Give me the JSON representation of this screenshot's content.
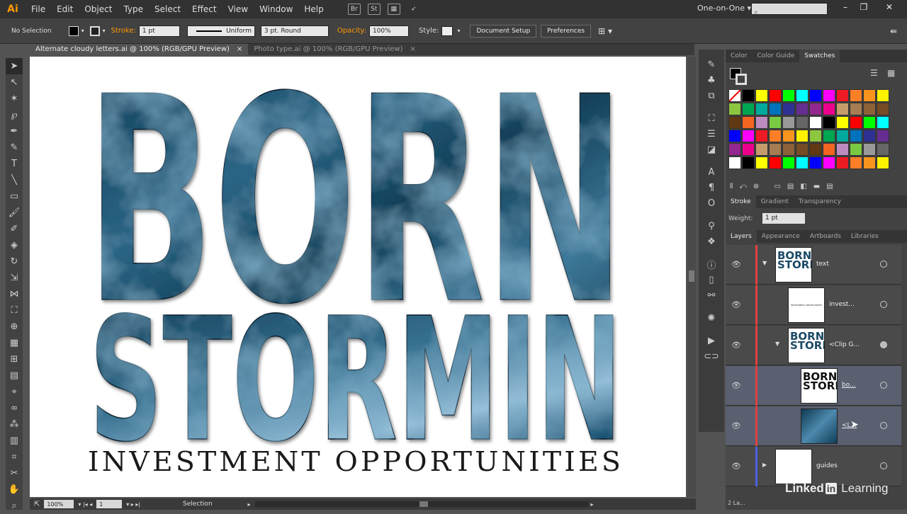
{
  "app": {
    "logo": "Ai",
    "menu": [
      "File",
      "Edit",
      "Object",
      "Type",
      "Select",
      "Effect",
      "View",
      "Window",
      "Help"
    ],
    "workspace": "One-on-One",
    "app_icons": [
      "Br",
      "St",
      "arrange-icon",
      "gpu-icon"
    ]
  },
  "control": {
    "selection": "No Selection",
    "stroke_label": "Stroke:",
    "stroke_weight": "1 pt",
    "profile": "Uniform",
    "brush": "3 pt. Round",
    "opacity_label": "Opacity:",
    "opacity": "100%",
    "style_label": "Style:",
    "doc_setup": "Document Setup",
    "preferences": "Preferences"
  },
  "tabs": [
    {
      "label": "Alternate cloudy letters.ai @ 100% (RGB/GPU Preview)",
      "close": "×"
    },
    {
      "label": "Photo type.ai @ 100% (RGB/GPU Preview)",
      "close": "×"
    }
  ],
  "art": {
    "line1": "BORN",
    "line2": "STORMIN",
    "line3": "INVESTMENT OPPORTUNITIES"
  },
  "status": {
    "zoom": "100%",
    "page": "1",
    "tool": "Selection"
  },
  "swatch_panel": {
    "tabs": [
      "Color",
      "Color Guide",
      "Swatches"
    ],
    "active": "Swatches"
  },
  "stroke_panel": {
    "tabs": [
      "Stroke",
      "Gradient",
      "Transparency"
    ],
    "weight_label": "Weight:",
    "weight": "1 pt"
  },
  "layers_panel": {
    "tabs": [
      "Layers",
      "Appearance",
      "Artboards",
      "Libraries"
    ],
    "count": "2 La...",
    "rows": [
      {
        "name": "text",
        "thumb": "BORN STORMIN"
      },
      {
        "name": "invest...",
        "thumb": "INVESTMENT OPPORTUNITIES"
      },
      {
        "name": "<Clip G...",
        "thumb": "BORN STORMIN"
      },
      {
        "name": "bo...",
        "thumb": "BORN STORMIN"
      },
      {
        "name": "<L...",
        "thumb": ""
      },
      {
        "name": "guides",
        "thumb": ""
      }
    ]
  },
  "watermark": {
    "brand1": "Linked",
    "brand2": "in",
    "brand3": "Learning"
  },
  "colors": {
    "cloud_dark": "#103a52",
    "cloud_mid": "#2e6888",
    "cloud_light": "#9cc4de",
    "ui_bg": "#535353",
    "accent": "#ff9a00"
  },
  "swatches": [
    "#ffffff",
    "#000000",
    "#ffff00",
    "#ff0000",
    "#00ff00",
    "#00ffff",
    "#0000ff",
    "#ff00ff",
    "#ed1c24",
    "#ff7f27",
    "#f7941d",
    "#fff200",
    "#8dc63f",
    "#00a651",
    "#00a99d",
    "#0072bc",
    "#2e3192",
    "#662d91",
    "#92278f",
    "#ec008c",
    "#c69c6d",
    "#a67c52",
    "#8c6239",
    "#754c24",
    "#603913",
    "#f26522",
    "#bd8cbf",
    "#7ac943",
    "#999999",
    "#666666"
  ]
}
